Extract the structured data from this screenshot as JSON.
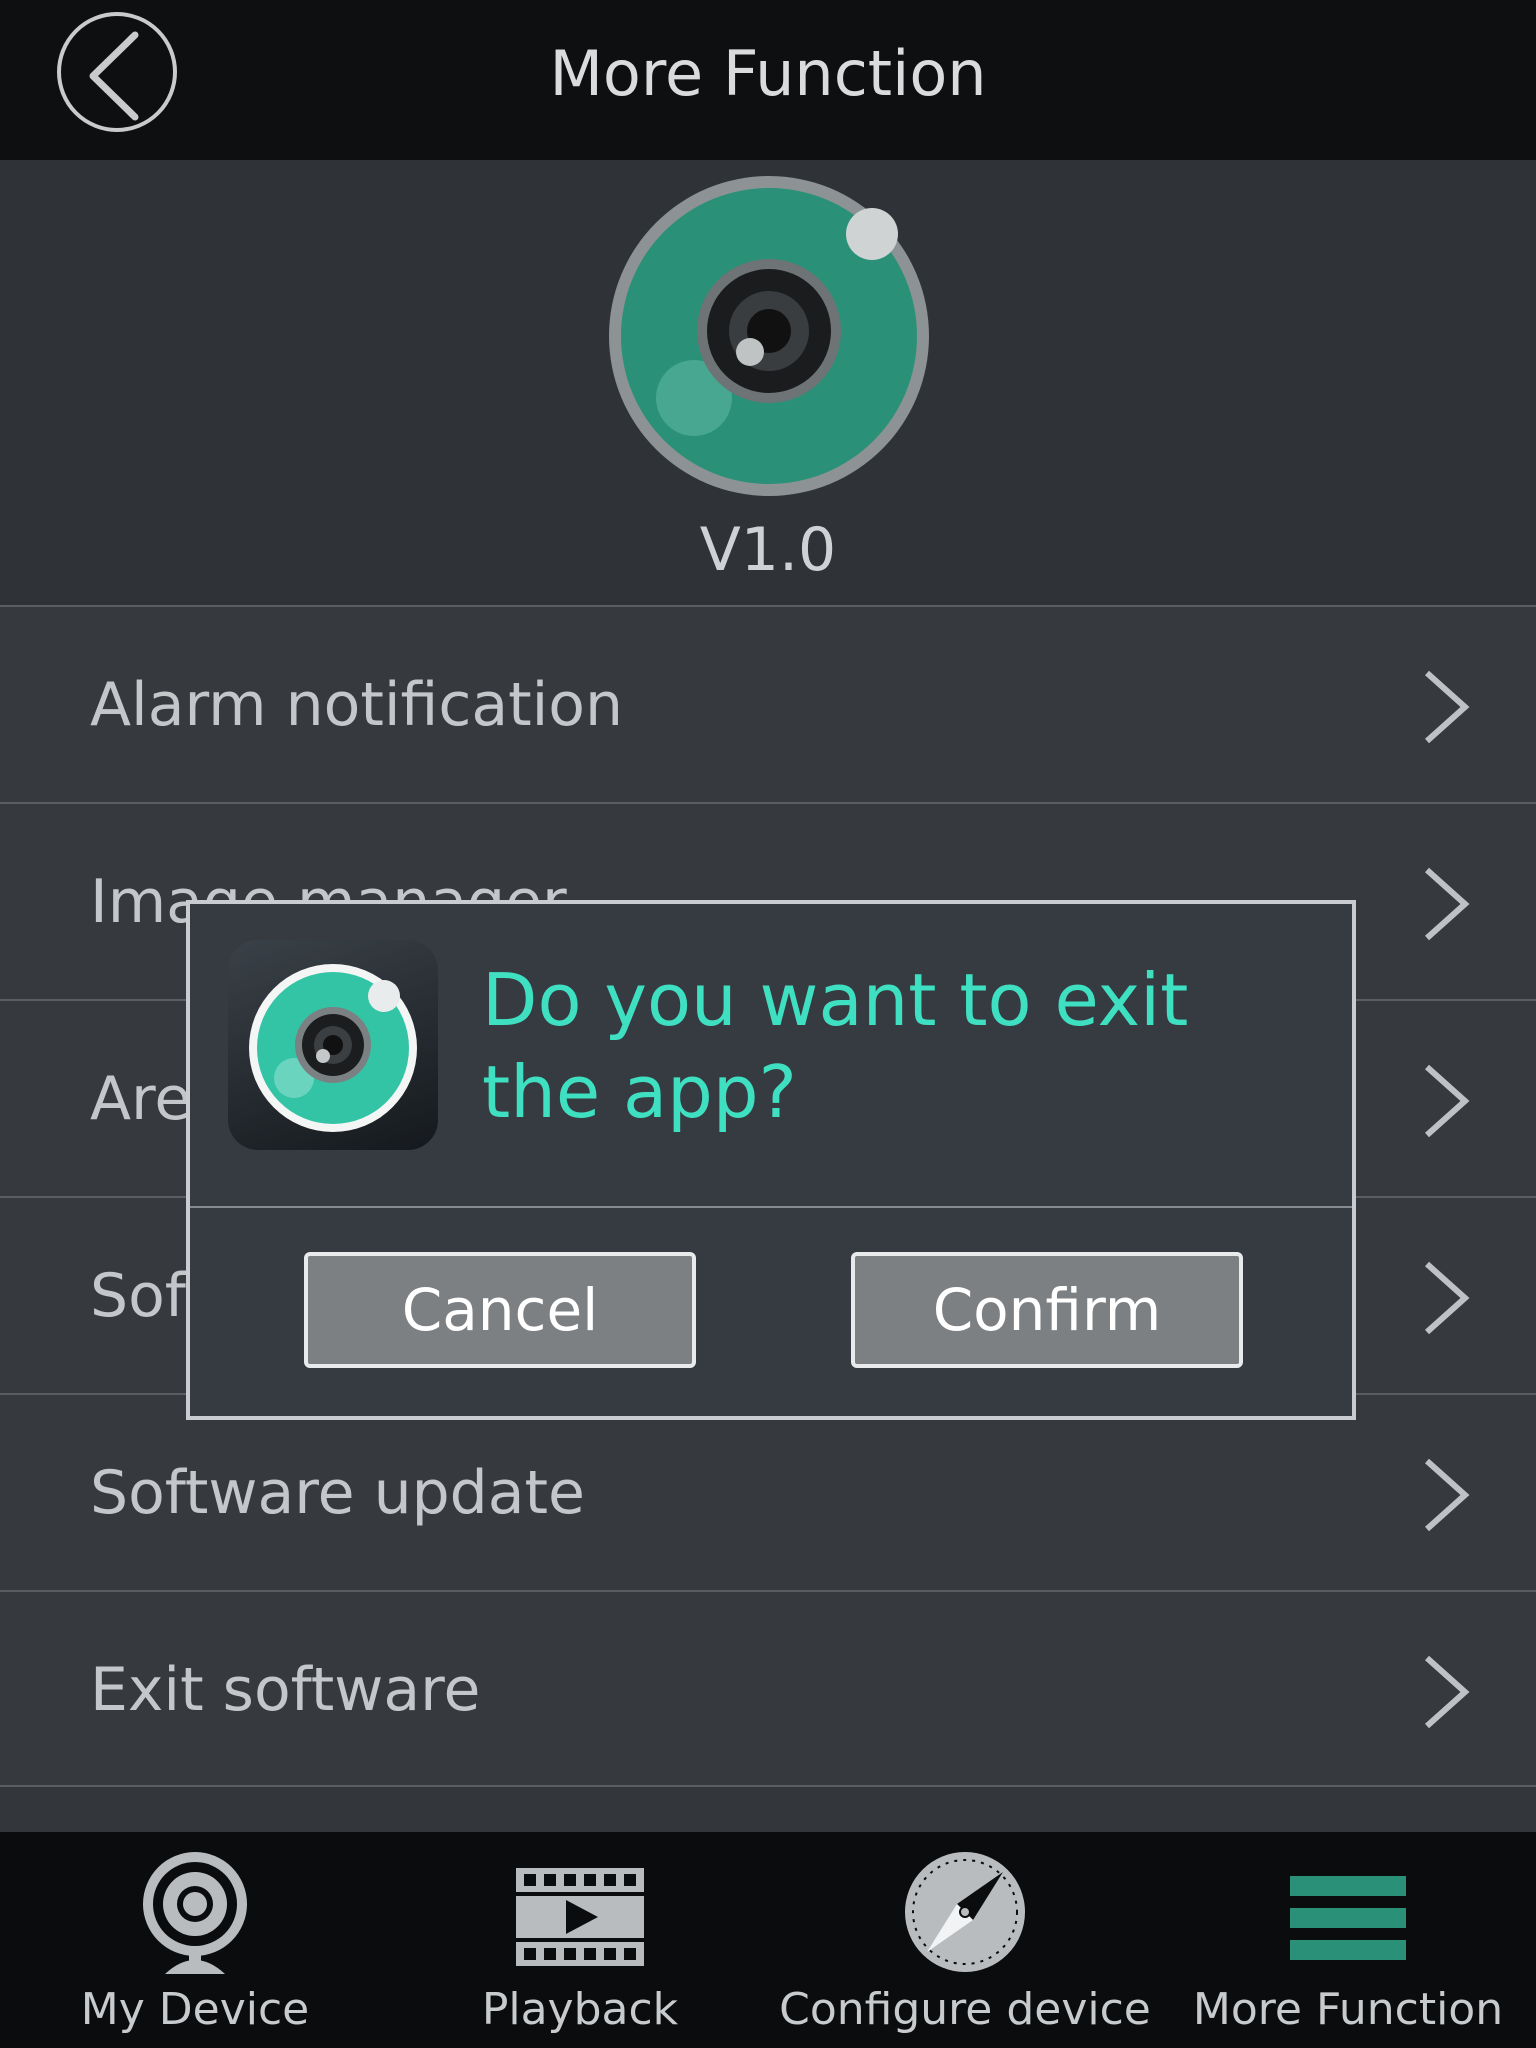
{
  "header": {
    "title": "More Function"
  },
  "hero": {
    "version": "V1.0"
  },
  "menu": {
    "items": [
      {
        "label": "Alarm notification"
      },
      {
        "label": "Image manager"
      },
      {
        "label": "Area"
      },
      {
        "label": "Software"
      },
      {
        "label": "Software update"
      },
      {
        "label": "Exit software"
      }
    ]
  },
  "dialog": {
    "message": "Do you want to exit the app?",
    "cancel_label": "Cancel",
    "confirm_label": "Confirm"
  },
  "tabbar": {
    "tabs": [
      {
        "label": "My Device",
        "icon": "webcam-icon"
      },
      {
        "label": "Playback",
        "icon": "film-play-icon"
      },
      {
        "label": "Configure device",
        "icon": "compass-icon"
      },
      {
        "label": "More Function",
        "icon": "menu-icon",
        "active": true
      }
    ]
  },
  "colors": {
    "accent": "#3fe0c2",
    "brand_green": "#2a9078",
    "header_bg": "#0e0f10",
    "body_bg": "#33373c"
  }
}
